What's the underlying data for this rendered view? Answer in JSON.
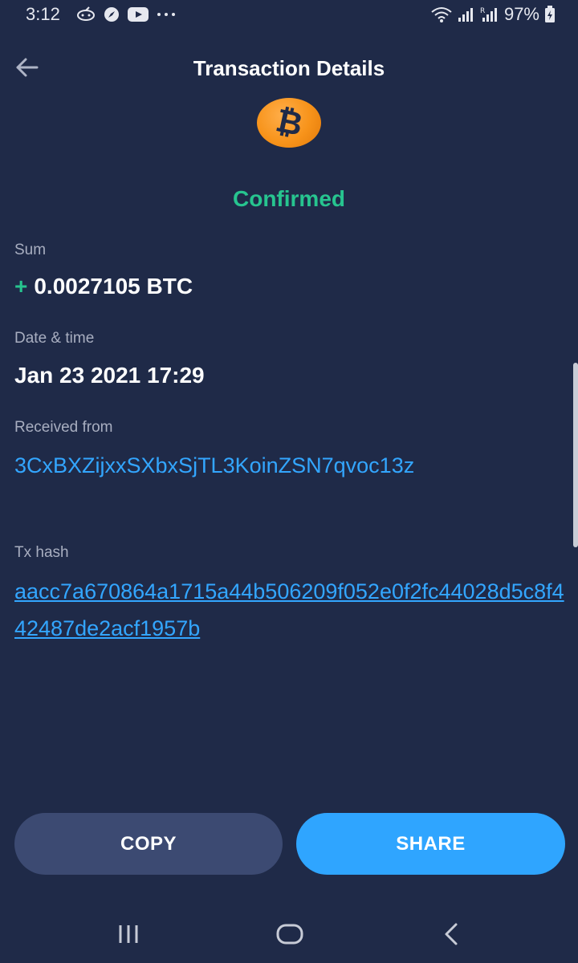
{
  "status_bar": {
    "time": "3:12",
    "battery": "97%",
    "left_icons": [
      "notification-icon",
      "compass-icon",
      "youtube-icon",
      "more-icon"
    ],
    "right_icons": [
      "wifi-icon",
      "signal-icon",
      "signal-roaming-icon",
      "battery-charging-icon"
    ]
  },
  "header": {
    "title": "Transaction Details",
    "back_icon": "arrow-left-icon"
  },
  "coin": {
    "icon": "bitcoin-icon",
    "glyph": "₿",
    "color": "#f7931a"
  },
  "status": {
    "text": "Confirmed",
    "color": "#27c48f"
  },
  "fields": {
    "sum": {
      "label": "Sum",
      "sign": "+",
      "value": "0.0027105 BTC"
    },
    "datetime": {
      "label": "Date & time",
      "value": "Jan 23 2021 17:29"
    },
    "received_from": {
      "label": "Received from",
      "value": "3CxBXZijxxSXbxSjTL3KoinZSN7qvoc13z"
    },
    "tx_hash": {
      "label": "Tx hash",
      "value": "aacc7a670864a1715a44b506209f052e0f2fc44028d5c8f442487de2acf1957b"
    }
  },
  "buttons": {
    "copy": "COPY",
    "share": "SHARE"
  },
  "nav": {
    "icons": [
      "recents-icon",
      "home-icon",
      "back-icon"
    ]
  },
  "colors": {
    "background": "#1f2a48",
    "accent_blue": "#2fa5ff",
    "link_blue": "#33a6ff",
    "copy_button": "#3c4a72"
  }
}
